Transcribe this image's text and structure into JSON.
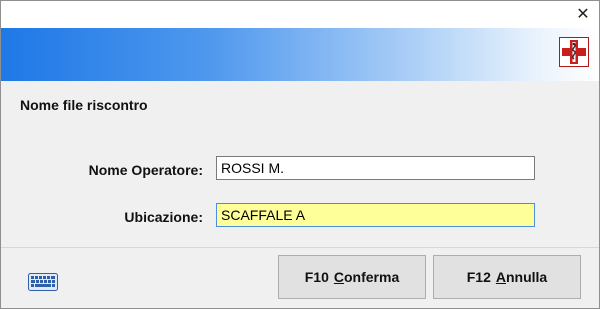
{
  "titlebar": {
    "close_glyph": "✕",
    "close_icon": "close-icon"
  },
  "banner": {
    "logo_icon": "pharmacy-cross-logo",
    "gradient_start": "#1e78e6",
    "gradient_end": "#ffffff"
  },
  "form": {
    "section_title": "Nome file riscontro",
    "operatore": {
      "label": "Nome Operatore:",
      "value": "ROSSI M."
    },
    "ubicazione": {
      "label": "Ubicazione:",
      "value": "SCAFFALE A",
      "focus_color": "#ffff99"
    }
  },
  "footer": {
    "keyboard_icon": "keyboard-icon",
    "confirm": {
      "key": "F10",
      "mnemonic": "C",
      "rest": "onferma"
    },
    "cancel": {
      "key": "F12",
      "mnemonic": "A",
      "rest": "nnulla"
    }
  }
}
